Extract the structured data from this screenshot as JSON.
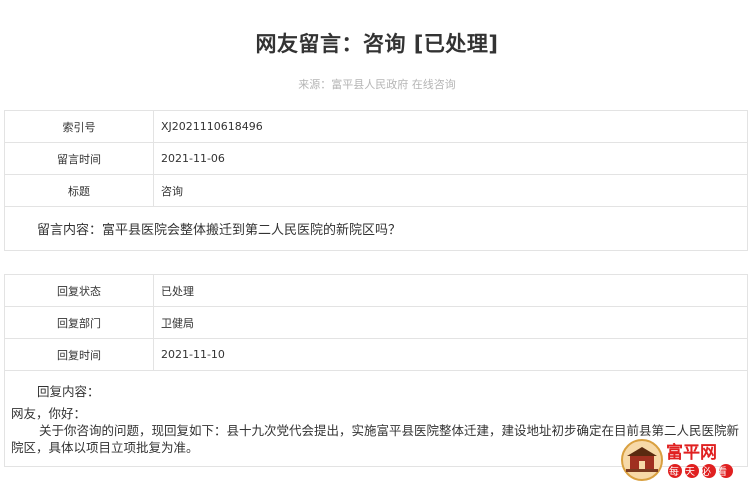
{
  "header": {
    "title": "网友留言：咨询 [已处理]",
    "source": "来源：富平县人民政府 在线咨询"
  },
  "message": {
    "index_label": "索引号",
    "index_value": "XJ2021110618496",
    "time_label": "留言时间",
    "time_value": "2021-11-06",
    "subject_label": "标题",
    "subject_value": "咨询",
    "content": "留言内容：富平县医院会整体搬迁到第二人民医院的新院区吗？"
  },
  "reply": {
    "status_label": "回复状态",
    "status_value": "已处理",
    "dept_label": "回复部门",
    "dept_value": "卫健局",
    "time_label": "回复时间",
    "time_value": "2021-11-10",
    "content_label": "回复内容：",
    "greeting": "网友，你好：",
    "body": "关于你咨询的问题，现回复如下：县十九次党代会提出，实施富平县医院整体迁建，建设地址初步确定在目前县第二人民医院新院区，具体以项目立项批复为准。"
  },
  "watermark": {
    "brand_text": "富平网",
    "slogan": "每天必看",
    "brand_color": "#e02020",
    "icon": "city-gate-icon"
  }
}
